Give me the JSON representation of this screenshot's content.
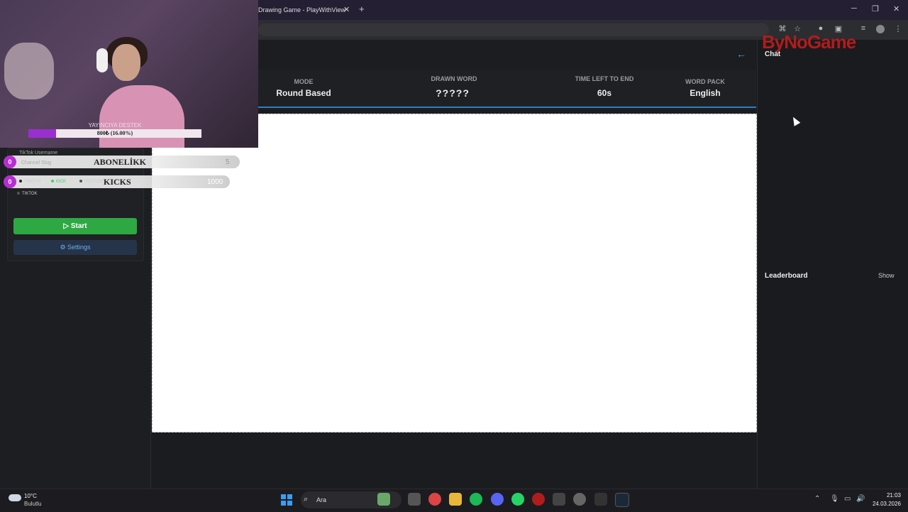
{
  "browser": {
    "tab_title": "Drawing Game - PlayWithView",
    "close_tab": "✕",
    "new_tab": "+",
    "minimize": "─",
    "maximize": "❐",
    "close_window": "✕",
    "menu": "⋮"
  },
  "game": {
    "back": "←",
    "mode_label": "MODE",
    "mode_value": "Round Based",
    "drawn_word_label": "DRAWN WORD",
    "drawn_word_value": "?????",
    "time_label": "TIME LEFT TO END",
    "time_value": "60s",
    "word_pack_label": "WORD PACK",
    "word_pack_value": "English",
    "start_label": "Start",
    "settings_label": "Settings",
    "tiktok_username_label": "TikTok Username",
    "channel_slug_placeholder": "Channel Slug",
    "platforms": [
      "TWITCH",
      "KICK",
      "YOUTUBE",
      "TIKTOK"
    ]
  },
  "sidebar": {
    "chat_title": "Chat",
    "leaderboard_title": "Leaderboard",
    "show_label": "Show"
  },
  "overlay": {
    "watermark": "ByNoGame",
    "donation_label": "YAYINCIYA DESTEK",
    "donation_text": "800₺ (16.00%)",
    "donation_progress": 0.16,
    "goals": [
      {
        "badge": "0",
        "title": "ABONELİKK",
        "count": "5"
      },
      {
        "badge": "0",
        "title": "KICKS",
        "count": "1000"
      }
    ]
  },
  "taskbar": {
    "weather_temp": "10°C",
    "weather_condition": "Bulutlu",
    "search_placeholder": "Ara",
    "time": "21:03",
    "date": "24.03.2026"
  },
  "colors": {
    "accent_blue": "#2f7fc1",
    "start_green": "#2ea843",
    "donation_purple": "#9a2fd0"
  }
}
